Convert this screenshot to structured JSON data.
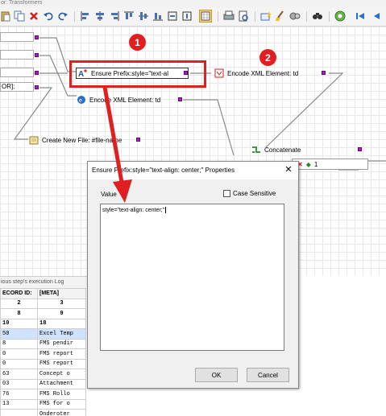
{
  "window": {
    "title": "or: Transformers"
  },
  "toolbar": {
    "icons": [
      "paste-icon",
      "copy-icon",
      "delete-icon",
      "undo-icon",
      "redo-icon",
      "align-left-icon",
      "align-center-icon",
      "align-right-icon",
      "align-top-icon",
      "align-middle-icon",
      "align-bottom-icon",
      "grid-icon",
      "print-icon",
      "print-preview-icon",
      "add-transformer-icon",
      "clean-icon",
      "tools-icon",
      "find-icon",
      "settings-icon",
      "first-icon",
      "previous-icon"
    ]
  },
  "canvas": {
    "left_fields": [
      "",
      "",
      "",
      "OR]:"
    ],
    "nodes": {
      "ensure_prefix": "Ensure Prefix:style=\"text-al",
      "encode_xml_1": "Encode XML Element: td",
      "encode_xml_2": "Encode XML Element: td",
      "create_new_file": "Create New File: #file-name",
      "concatenate": "Concatenate",
      "concat_input": "1"
    },
    "badges": [
      "1",
      "2"
    ]
  },
  "log": {
    "heading": "ious step's execution Log",
    "columns": [
      "ECORD ID:",
      "[META]"
    ],
    "header_rows": [
      [
        "2",
        "3"
      ],
      [
        "8",
        "9"
      ],
      [
        "10",
        "18"
      ]
    ],
    "rows": [
      [
        "50",
        "Excel Temp"
      ],
      [
        "8",
        "FMS pendir"
      ],
      [
        "0",
        "FMS report"
      ],
      [
        "0",
        "FMS report"
      ],
      [
        "63",
        "Concept o"
      ],
      [
        "03",
        "Attachment"
      ],
      [
        "76",
        "FMS Rollo"
      ],
      [
        "13",
        "FMS for o"
      ],
      [
        "",
        "Onderoter"
      ]
    ]
  },
  "dialog": {
    "title": "Ensure Prefix:style=\"text-align: center;\" Properties",
    "close_label": "✕",
    "value_label": "Value",
    "case_sensitive_label": "Case Sensitive",
    "case_sensitive_checked": false,
    "value_text": "style=\"text-align: center;\"",
    "ok_label": "OK",
    "cancel_label": "Cancel"
  },
  "colors": {
    "accent_red": "#e02020",
    "port_purple": "#a020c0",
    "selection_blue": "#cfe2ff"
  }
}
